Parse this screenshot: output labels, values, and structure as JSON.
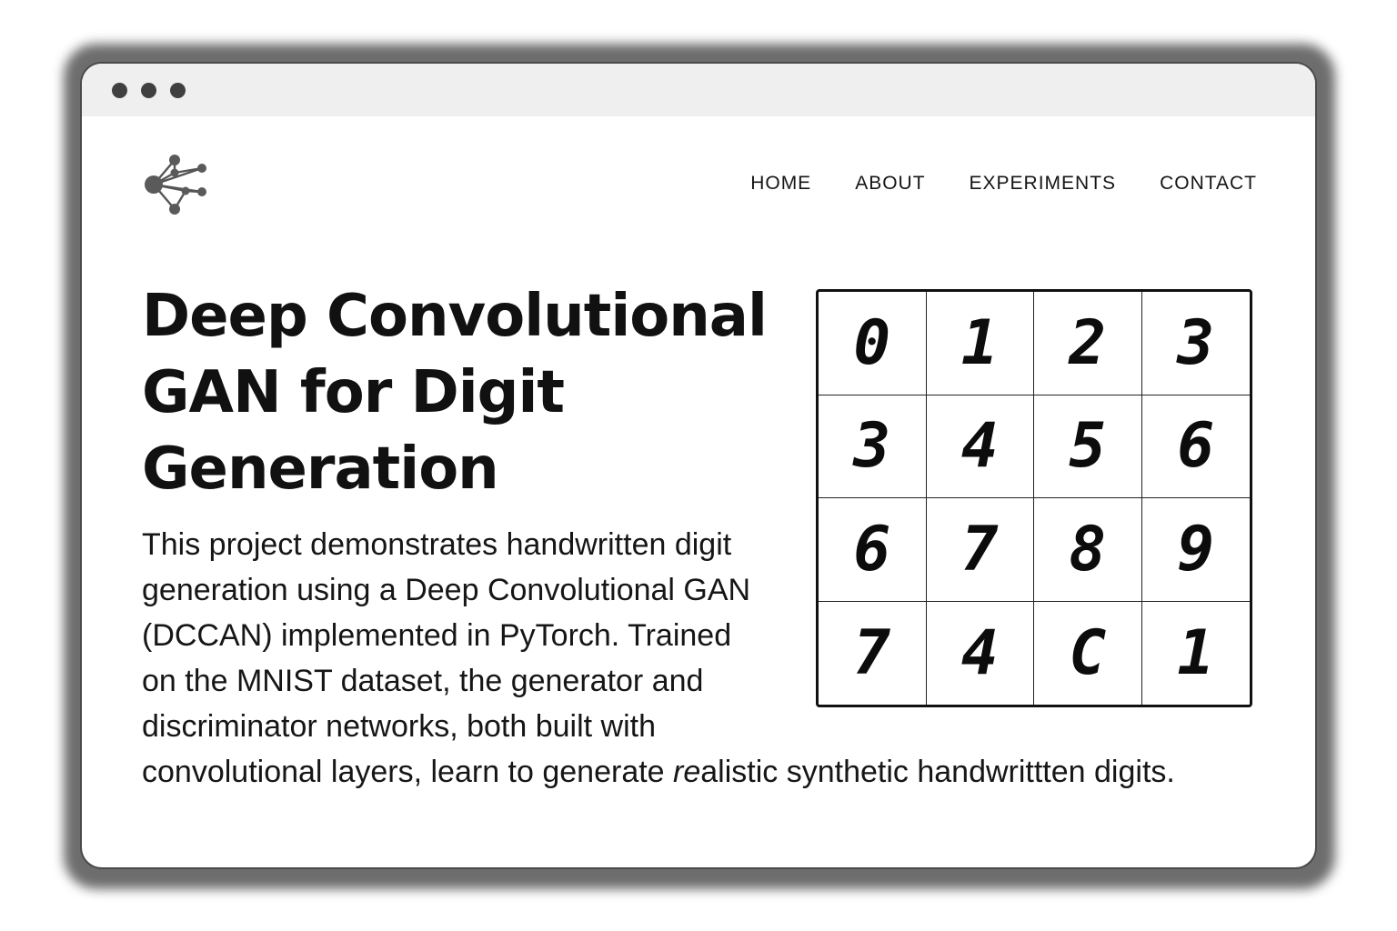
{
  "window": {
    "controls": [
      "close",
      "minimize",
      "maximize"
    ]
  },
  "header": {
    "logo_icon": "network-nodes-icon",
    "nav": [
      {
        "label": "HOME"
      },
      {
        "label": "ABOUT"
      },
      {
        "label": "EXPERIMENTS"
      },
      {
        "label": "CONTACT"
      }
    ]
  },
  "hero": {
    "title_lines": [
      "Deep Convolutional",
      "GAN for Digit",
      "Generation"
    ],
    "description_lines": [
      "This project demonstrates handwritten digit",
      "generation using a Deep Convolutional GAN",
      "(DCCAN) implemented in PyTorch. Trained",
      "on the MNIST dataset, the generator and",
      "discriminator networks, both built with"
    ],
    "description_last": {
      "before": "convolutional layers, learn to generate ",
      "italic": "re",
      "after": "alistic synthetic handwrittten digits."
    }
  },
  "digit_grid": {
    "rows": [
      [
        "0",
        "1",
        "2",
        "3"
      ],
      [
        "3",
        "4",
        "5",
        "6"
      ],
      [
        "6",
        "7",
        "8",
        "9"
      ],
      [
        "7",
        "4",
        "C",
        "1"
      ]
    ]
  }
}
